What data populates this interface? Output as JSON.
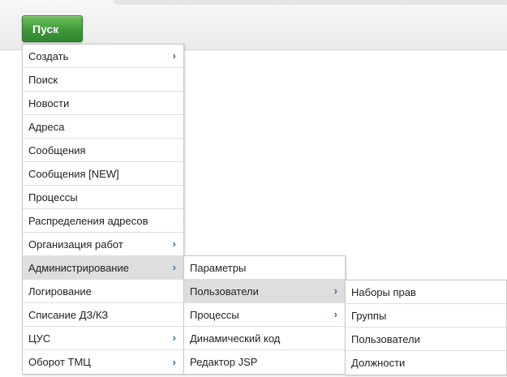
{
  "start_button": {
    "label": "Пуск"
  },
  "main_menu": {
    "items": [
      {
        "label": "Создать",
        "submenu": true,
        "active": false
      },
      {
        "label": "Поиск",
        "submenu": false,
        "active": false
      },
      {
        "label": "Новости",
        "submenu": false,
        "active": false
      },
      {
        "label": "Адреса",
        "submenu": false,
        "active": false
      },
      {
        "label": "Сообщения",
        "submenu": false,
        "active": false
      },
      {
        "label": "Сообщения [NEW]",
        "submenu": false,
        "active": false
      },
      {
        "label": "Процессы",
        "submenu": false,
        "active": false
      },
      {
        "label": "Распределения адресов",
        "submenu": false,
        "active": false
      },
      {
        "label": "Организация работ",
        "submenu": true,
        "active": false
      },
      {
        "label": "Администрирование",
        "submenu": true,
        "active": true
      },
      {
        "label": "Логирование",
        "submenu": false,
        "active": false
      },
      {
        "label": "Списание ДЗ/КЗ",
        "submenu": false,
        "active": false
      },
      {
        "label": "ЦУС",
        "submenu": true,
        "active": false
      },
      {
        "label": "Оборот ТМЦ",
        "submenu": true,
        "active": false
      }
    ]
  },
  "admin_menu": {
    "items": [
      {
        "label": "Параметры",
        "submenu": false,
        "active": false
      },
      {
        "label": "Пользователи",
        "submenu": true,
        "active": true
      },
      {
        "label": "Процессы",
        "submenu": true,
        "active": false
      },
      {
        "label": "Динамический код",
        "submenu": false,
        "active": false
      },
      {
        "label": "Редактор JSP",
        "submenu": false,
        "active": false
      }
    ]
  },
  "users_menu": {
    "items": [
      {
        "label": "Наборы прав",
        "submenu": false,
        "active": false
      },
      {
        "label": "Группы",
        "submenu": false,
        "active": false
      },
      {
        "label": "Пользователи",
        "submenu": false,
        "active": false
      },
      {
        "label": "Должности",
        "submenu": false,
        "active": false
      }
    ]
  },
  "icons": {
    "submenu_arrow": "chevron-right-icon"
  },
  "colors": {
    "accent": "#2a6fb0",
    "start_button": "#3f9a3a",
    "active_row": "#dedede"
  }
}
